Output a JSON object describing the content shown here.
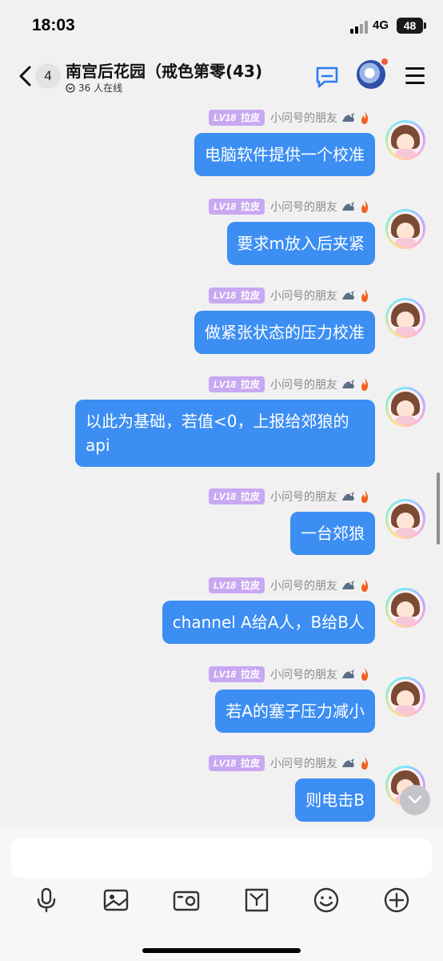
{
  "status_bar": {
    "time": "18:03",
    "network": "4G",
    "battery": "48"
  },
  "header": {
    "unread_count": "4",
    "title": "南宫后花园（戒色第零(43)",
    "online_text": "36 人在线",
    "icons": [
      "back-icon",
      "chat-icon",
      "group-avatar",
      "menu-icon"
    ],
    "notification_color": "#f05a3c"
  },
  "sender": {
    "level": "LV18",
    "level_title": "拉皮",
    "nickname": "小问号的朋友",
    "badge_icons": [
      "dragon-icon",
      "flame-icon"
    ],
    "level_color": "#c9a8f2"
  },
  "messages": [
    {
      "text": "电脑软件提供一个校准"
    },
    {
      "text": "要求m放入后夹紧"
    },
    {
      "text": "做紧张状态的压力校准"
    },
    {
      "text": "以此为基础，若值<0，上报给郊狼的api"
    },
    {
      "text": "一台郊狼"
    },
    {
      "text": "channel A给A人，B给B人"
    },
    {
      "text": "若A的塞子压力减小"
    },
    {
      "text": "则电击B"
    }
  ],
  "bubble_color": "#3c8ef2",
  "input": {
    "placeholder": "",
    "value": ""
  },
  "toolbar": [
    "microphone-icon",
    "image-icon",
    "camera-icon",
    "file-icon",
    "emoji-icon",
    "plus-icon"
  ]
}
